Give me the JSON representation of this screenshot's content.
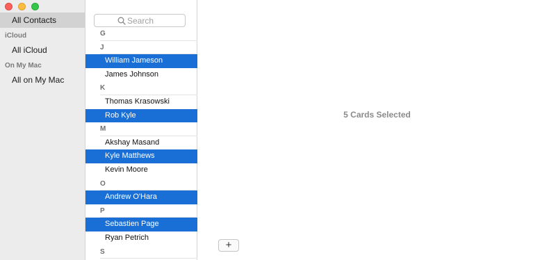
{
  "sidebar": {
    "all_contacts": "All Contacts",
    "icloud_header": "iCloud",
    "all_icloud": "All iCloud",
    "onmymac_header": "On My Mac",
    "all_onmymac": "All on My Mac"
  },
  "search": {
    "placeholder": "Search"
  },
  "list": {
    "letters": [
      "G",
      "J",
      "K",
      "M",
      "O",
      "P",
      "S"
    ],
    "contacts": [
      {
        "name": "William Jameson",
        "selected": true
      },
      {
        "name": "James Johnson",
        "selected": false
      },
      {
        "name": "Thomas Krasowski",
        "selected": false
      },
      {
        "name": "Rob Kyle",
        "selected": true
      },
      {
        "name": "Akshay Masand",
        "selected": false
      },
      {
        "name": "Kyle Matthews",
        "selected": true
      },
      {
        "name": "Kevin Moore",
        "selected": false
      },
      {
        "name": "Andrew O'Hara",
        "selected": true
      },
      {
        "name": "Sebastien Page",
        "selected": true
      },
      {
        "name": "Ryan Petrich",
        "selected": false
      }
    ]
  },
  "detail": {
    "selection_text": "5 Cards Selected",
    "add_label": "+"
  },
  "colors": {
    "selection": "#1a6fd6",
    "sidebar_bg": "#ececec"
  }
}
